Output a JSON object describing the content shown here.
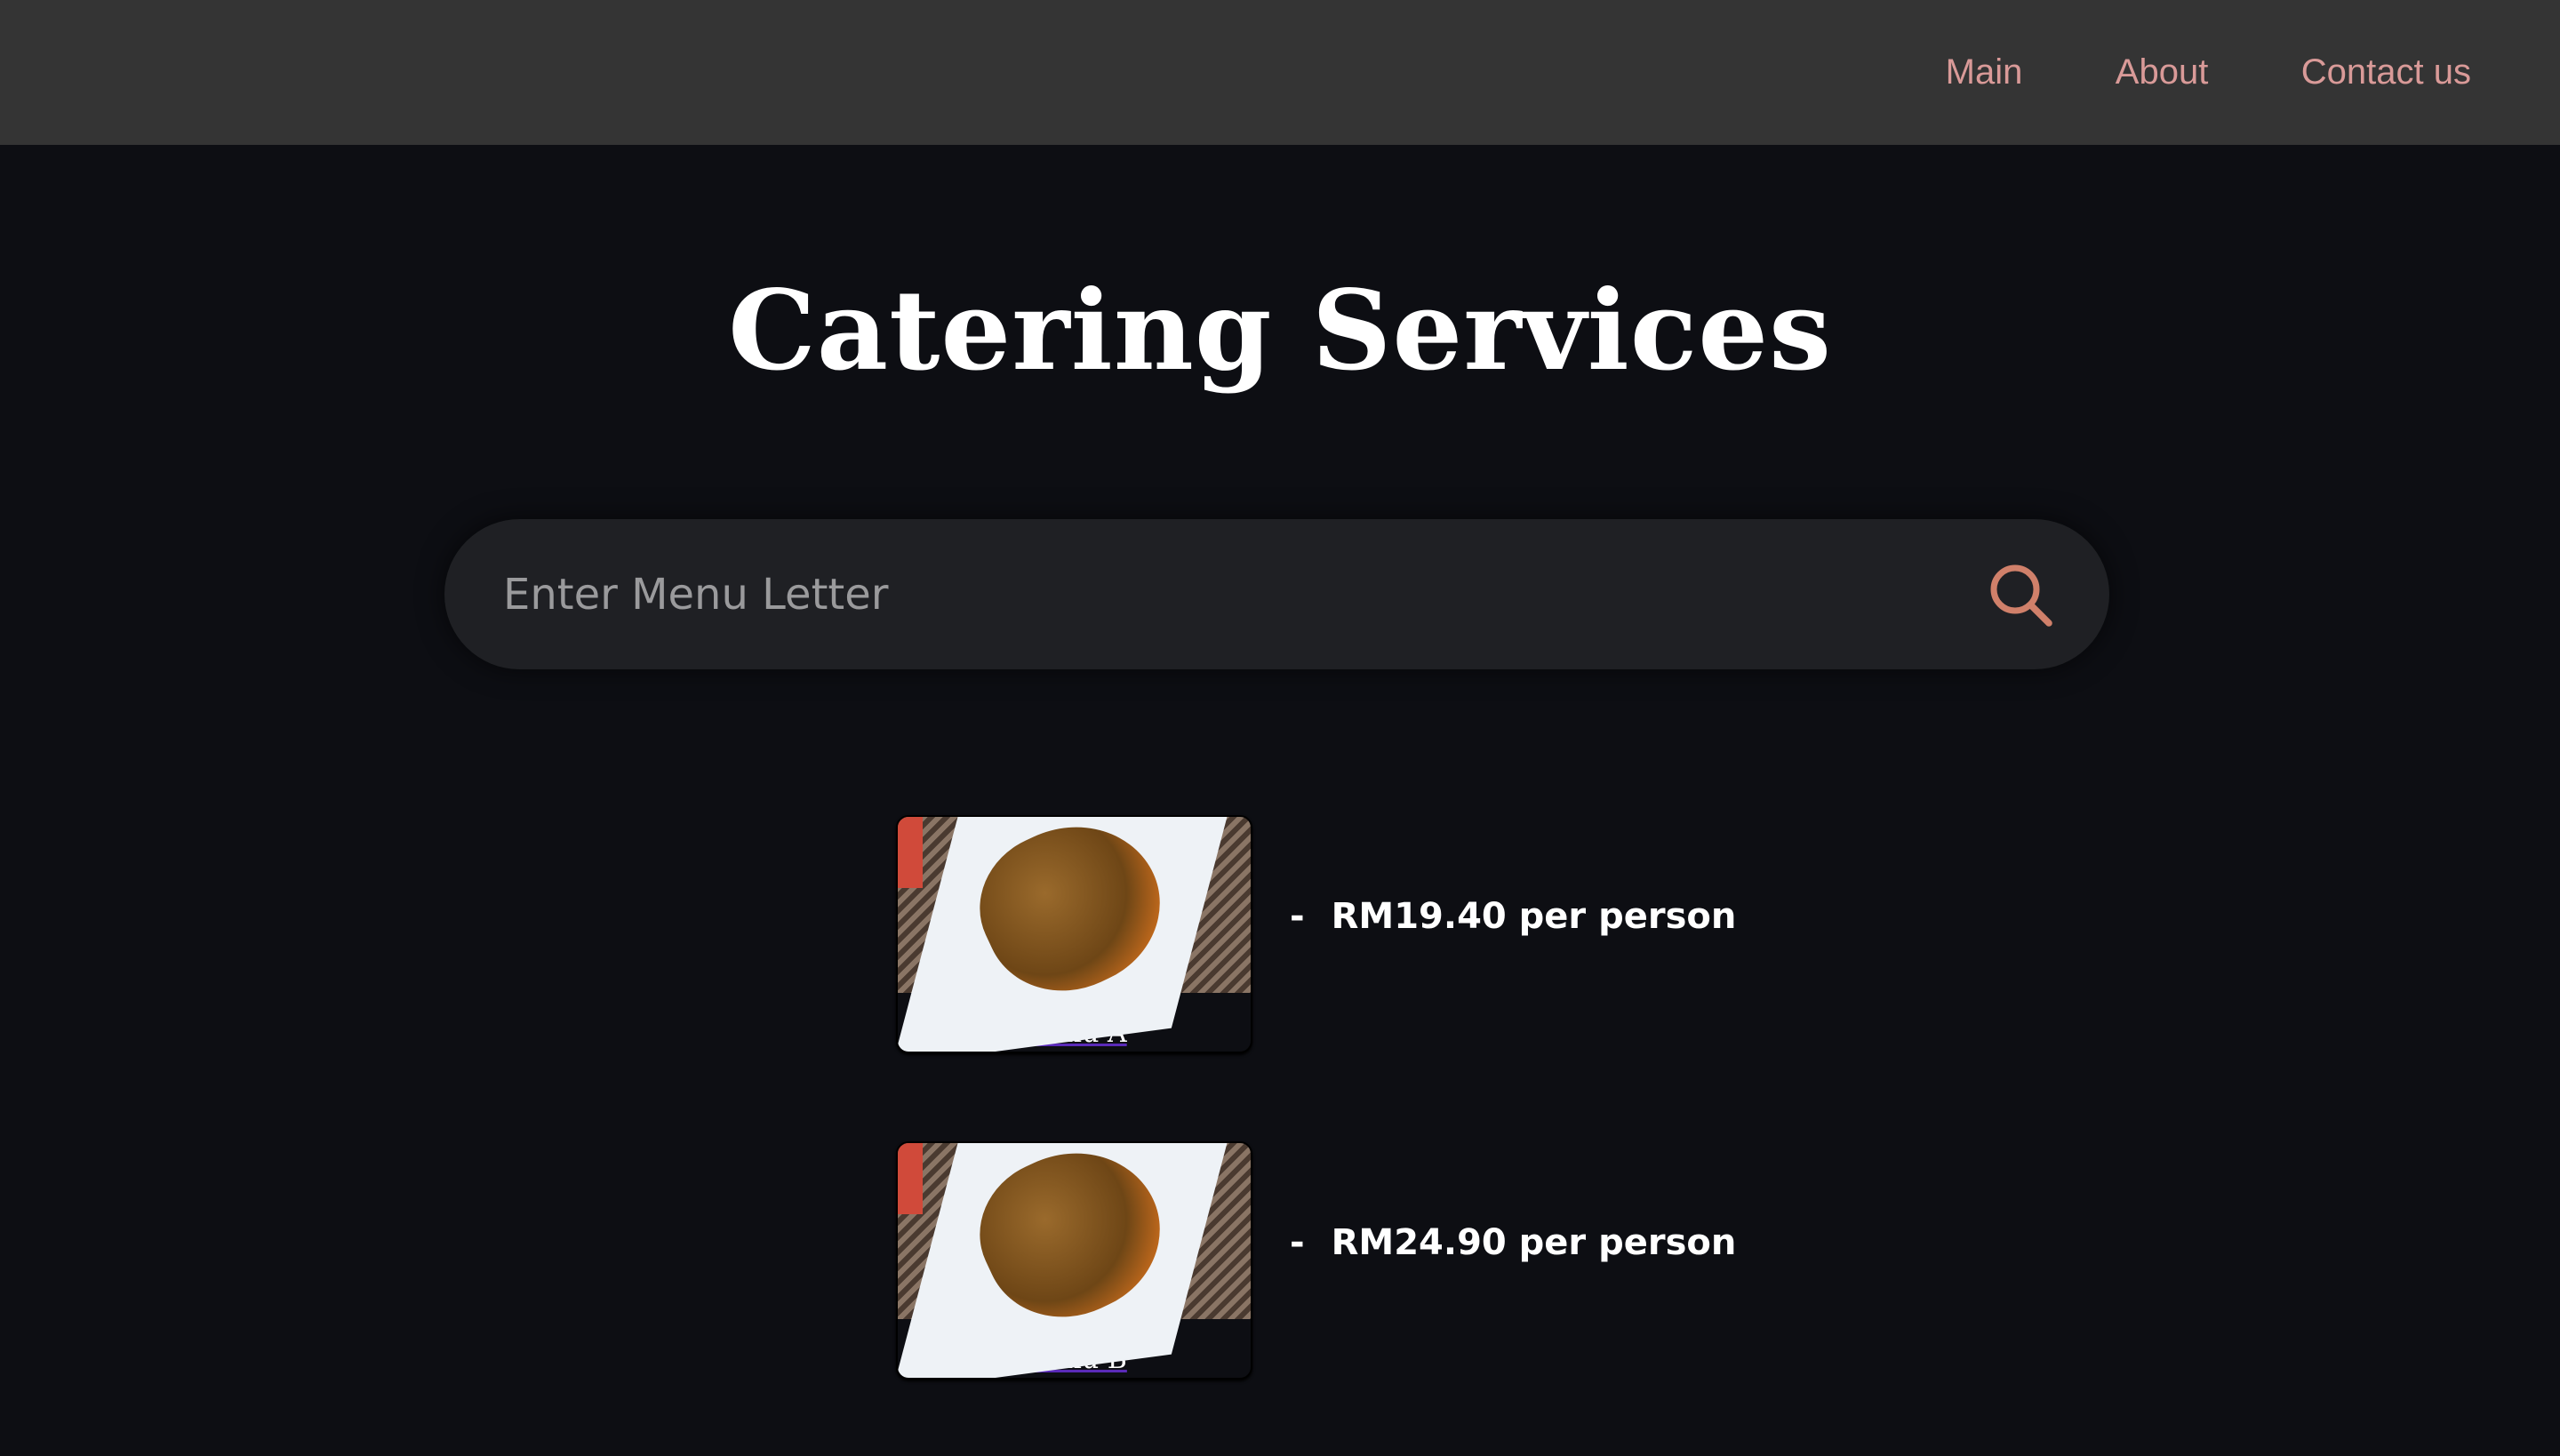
{
  "nav": {
    "items": [
      "Main",
      "About",
      "Contact us"
    ]
  },
  "page": {
    "title": "Catering Services"
  },
  "search": {
    "placeholder": "Enter Menu Letter",
    "value": "",
    "icon": "search-icon",
    "icon_color": "#d0806a"
  },
  "menus": [
    {
      "name": "Menu A",
      "dash": "-",
      "price": "RM19.40 per person"
    },
    {
      "name": "Menu B",
      "dash": "-",
      "price": "RM24.90 per person"
    }
  ],
  "colors": {
    "nav_link": "#d99a98",
    "header_bg": "#343434",
    "page_bg": "#0d0e13"
  }
}
